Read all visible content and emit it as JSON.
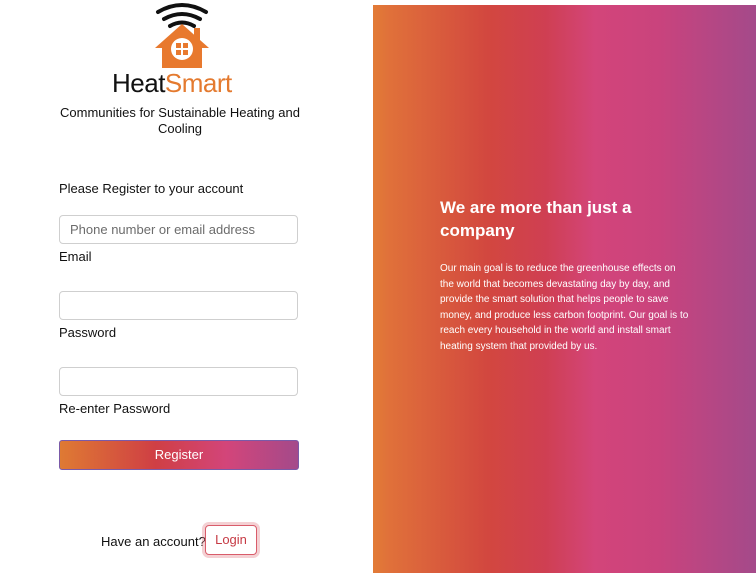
{
  "brand": {
    "name_part1": "Heat",
    "name_part2": "Smart",
    "tagline": "Communities for Sustainable Heating and Cooling",
    "colors": {
      "accent": "#e47a2f",
      "gradient_start": "#e27b36",
      "gradient_mid": "#cf3f52",
      "gradient_end": "#a44a8a"
    }
  },
  "form": {
    "heading": "Please Register to your account",
    "email": {
      "placeholder": "Phone number or email address",
      "value": "",
      "label": "Email"
    },
    "password": {
      "value": "",
      "label": "Password"
    },
    "reenter": {
      "value": "",
      "label": "Re-enter Password"
    },
    "register_label": "Register"
  },
  "footer": {
    "have_account": "Have an account?",
    "login_label": "Login"
  },
  "hero": {
    "title": "We are more than just a company",
    "text": "Our main goal is to reduce the greenhouse effects on the world that becomes devastating day by day, and provide the smart solution that helps people to save money, and produce less carbon footprint. Our goal is to reach every household in the world and install smart heating system that provided by us."
  },
  "icons": {
    "logo": "house-wifi-icon"
  }
}
